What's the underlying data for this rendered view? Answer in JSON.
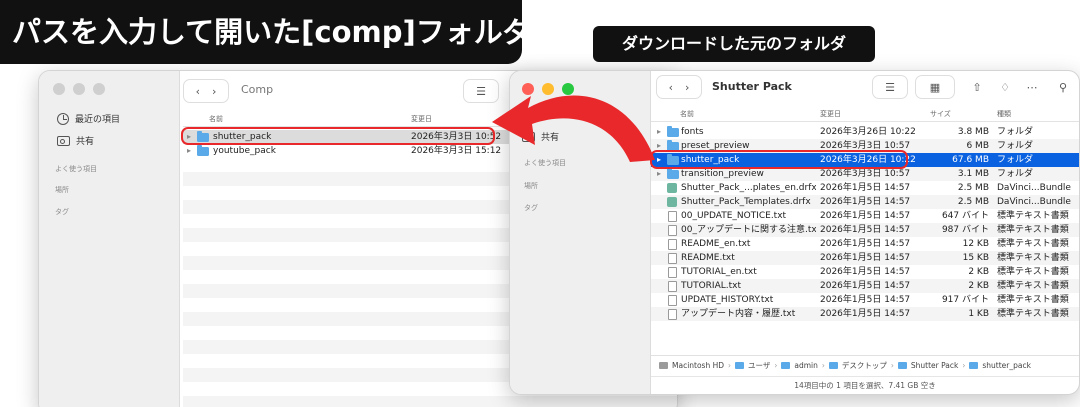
{
  "captions": {
    "main": "パスを入力して開いた[comp]フォルダ",
    "sub": "ダウンロードした元のフォルダ"
  },
  "left_window": {
    "title": "Comp",
    "columns": {
      "name": "名前",
      "modified": "変更日"
    },
    "rows": [
      {
        "name": "shutter_pack",
        "date": "2026年3月3日 10:52"
      },
      {
        "name": "youtube_pack",
        "date": "2026年3月3日 15:12"
      }
    ]
  },
  "right_window": {
    "title": "Shutter Pack",
    "columns": {
      "name": "名前",
      "modified": "変更日",
      "size": "サイズ",
      "kind": "種類"
    },
    "rows": [
      {
        "name": "fonts",
        "date": "2026年3月26日 10:22",
        "size": "3.8 MB",
        "kind": "フォルダ",
        "icon": "folder"
      },
      {
        "name": "preset_preview",
        "date": "2026年3月3日 10:57",
        "size": "6 MB",
        "kind": "フォルダ",
        "icon": "folder"
      },
      {
        "name": "shutter_pack",
        "date": "2026年3月26日 10:22",
        "size": "67.6 MB",
        "kind": "フォルダ",
        "icon": "folder"
      },
      {
        "name": "transition_preview",
        "date": "2026年3月3日 10:57",
        "size": "3.1 MB",
        "kind": "フォルダ",
        "icon": "folder"
      },
      {
        "name": "Shutter_Pack_...plates_en.drfx",
        "date": "2026年1月5日 14:57",
        "size": "2.5 MB",
        "kind": "DaVinci...Bundle",
        "icon": "dvr"
      },
      {
        "name": "Shutter_Pack_Templates.drfx",
        "date": "2026年1月5日 14:57",
        "size": "2.5 MB",
        "kind": "DaVinci...Bundle",
        "icon": "dvr"
      },
      {
        "name": "00_UPDATE_NOTICE.txt",
        "date": "2026年1月5日 14:57",
        "size": "647 バイト",
        "kind": "標準テキスト書類",
        "icon": "doc"
      },
      {
        "name": "00_アップデートに関する注意.txt",
        "date": "2026年1月5日 14:57",
        "size": "987 バイト",
        "kind": "標準テキスト書類",
        "icon": "doc"
      },
      {
        "name": "README_en.txt",
        "date": "2026年1月5日 14:57",
        "size": "12 KB",
        "kind": "標準テキスト書類",
        "icon": "doc"
      },
      {
        "name": "README.txt",
        "date": "2026年1月5日 14:57",
        "size": "15 KB",
        "kind": "標準テキスト書類",
        "icon": "doc"
      },
      {
        "name": "TUTORIAL_en.txt",
        "date": "2026年1月5日 14:57",
        "size": "2 KB",
        "kind": "標準テキスト書類",
        "icon": "doc"
      },
      {
        "name": "TUTORIAL.txt",
        "date": "2026年1月5日 14:57",
        "size": "2 KB",
        "kind": "標準テキスト書類",
        "icon": "doc"
      },
      {
        "name": "UPDATE_HISTORY.txt",
        "date": "2026年1月5日 14:57",
        "size": "917 バイト",
        "kind": "標準テキスト書類",
        "icon": "doc"
      },
      {
        "name": "アップデート内容・履歴.txt",
        "date": "2026年1月5日 14:57",
        "size": "1 KB",
        "kind": "標準テキスト書類",
        "icon": "doc"
      }
    ],
    "path": [
      "Macintosh HD",
      "ユーザ",
      "admin",
      "デスクトップ",
      "Shutter Pack",
      "shutter_pack"
    ],
    "status": "14項目中の 1 項目を選択、7.41 GB 空き"
  },
  "sidebar": {
    "recent": "最近の項目",
    "shared": "共有",
    "favorites": "よく使う項目",
    "locations": "場所",
    "tags": "タグ"
  },
  "colors": {
    "selection_blue": "#0a62e0",
    "highlight_red": "#e8282a",
    "arrow_red": "#e8282a",
    "folder_blue": "#5aa9e8"
  }
}
